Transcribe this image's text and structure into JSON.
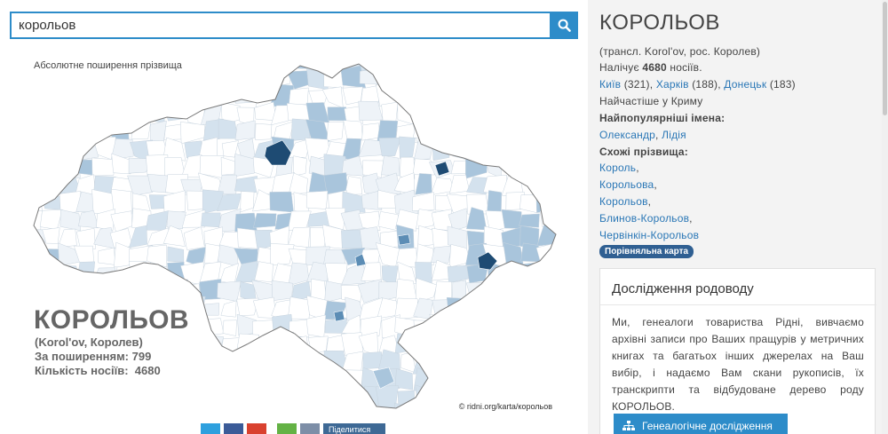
{
  "search": {
    "value": "корольов"
  },
  "map": {
    "heading": "Абсолютне поширення прізвища",
    "name": "КОРОЛЬОВ",
    "translit": "(Korol'ov, Королев)",
    "rank_line": "За поширенням: 799",
    "count_line": "Кількість носіїв:  4680",
    "credit": "© ridni.org/karta/корольов",
    "colors": {
      "base": "#eef3f8",
      "light": "#d4e2ee",
      "mid": "#a9c5dc",
      "dark": "#5c8db5",
      "darkest": "#1e4b73",
      "border": "#ffffff",
      "outline": "#7a7a7a"
    }
  },
  "share": {
    "buttons": [
      "twitter",
      "facebook",
      "google-plus",
      "odnoklassniki",
      "vkontakte",
      "share"
    ],
    "share_label": "Піделитися",
    "colors": [
      "#2ea0de",
      "#3b5b98",
      "#d9412f",
      "#64b245",
      "#7d8ea7",
      "#3e6995"
    ]
  },
  "sidebar": {
    "title": "КОРОЛЬОВ",
    "translit": "(трансл. Korol'ov, рос. Королев)",
    "count_prefix": "Налічує ",
    "count_value": "4680",
    "count_suffix": " носіїв.",
    "cities": [
      {
        "name": "Київ",
        "count": " (321), "
      },
      {
        "name": "Харків",
        "count": " (188), "
      },
      {
        "name": "Донецьк",
        "count": " (183)"
      }
    ],
    "frequent": "Найчастіше у Криму",
    "popular_names_label": "Найпопулярніші імена:",
    "popular_names": [
      {
        "name": "Олександр",
        "sep": ", "
      },
      {
        "name": "Лідія",
        "sep": ""
      }
    ],
    "similar_label": "Схожі прізвища:",
    "similar": [
      {
        "name": "Король",
        "sep": ","
      },
      {
        "name": "Корольова",
        "sep": ","
      },
      {
        "name": "Корольов",
        "sep": ","
      },
      {
        "name": "Блинов-Корольов",
        "sep": ","
      },
      {
        "name": "Червінкін-Корольов",
        "sep": ""
      }
    ],
    "compare_badge": "Порівняльна карта"
  },
  "research": {
    "title": "Дослідження родоводу",
    "text": "Ми, генеалоги товариства Рідні, вивчаємо архівні записи про Ваших пращурів у метричних книгах та багатьох інших джерелах на Ваш вибір, і надаємо Вам скани рукописів, їх транскрипти та відбудоване дерево роду КОРОЛЬОВ.",
    "button": "Генеалогічне дослідження"
  }
}
